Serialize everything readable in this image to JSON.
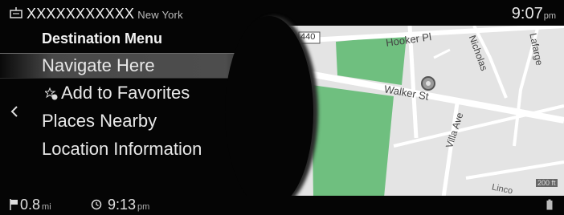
{
  "header": {
    "destination_name": "XXXXXXXXXXX",
    "destination_city": "New York",
    "time": "9:07",
    "time_suffix": "pm"
  },
  "menu": {
    "title": "Destination Menu",
    "items": [
      {
        "label": "Navigate Here",
        "selected": true
      },
      {
        "label": "Add to Favorites",
        "icon": "star-add-icon"
      },
      {
        "label": "Places Nearby"
      },
      {
        "label": "Location Information"
      }
    ]
  },
  "map": {
    "route_shield": "440",
    "streets": [
      "Hooker Pl",
      "Nicholas",
      "Lafarge",
      "Walker St",
      "Villa Ave",
      "Linco"
    ],
    "scale": "200 ft",
    "colors": {
      "park": "#6fbf7f",
      "land": "#e6e6e6",
      "road": "#ffffff"
    }
  },
  "status": {
    "distance": "0.8",
    "distance_unit": "mi",
    "eta": "9:13",
    "eta_suffix": "pm"
  },
  "colors": {
    "background": "#050505",
    "selected_row": "#5a5a5a",
    "text": "#e8e8e8"
  }
}
